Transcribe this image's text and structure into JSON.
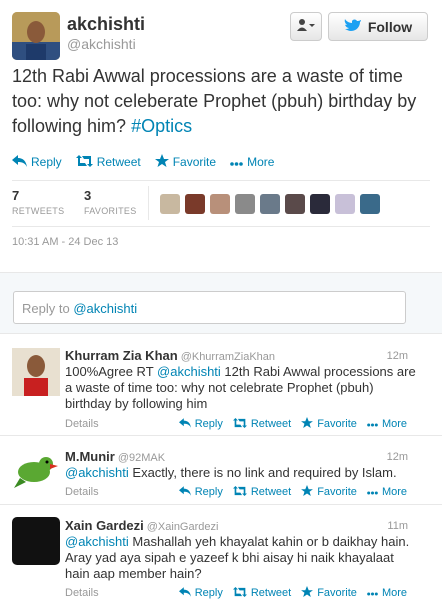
{
  "header": {
    "name": "akchishti",
    "handle": "@akchishti",
    "follow_label": "Follow"
  },
  "tweet": {
    "text": "12th Rabi Awwal processions are a waste of time too: why not celeberate Prophet (pbuh) birthday by following him?",
    "hashtag": "#Optics",
    "actions": {
      "reply": "Reply",
      "retweet": "Retweet",
      "favorite": "Favorite",
      "more": "More"
    },
    "retweets": "7",
    "retweets_label": "RETWEETS",
    "favorites": "3",
    "favorites_label": "FAVORITES",
    "date": "10:31 AM - 24 Dec 13"
  },
  "reply_box": {
    "placeholder": "Reply to ",
    "mention": "@akchishti"
  },
  "replies": [
    {
      "name": "Khurram Zia Khan",
      "handle": "@KhurramZiaKhan",
      "time": "12m",
      "text_pre": "100%Agree RT ",
      "mention": "@akchishti",
      "text_post": " 12th Rabi Awwal processions are a waste of time too: why not celebrate Prophet (pbuh) birthday by following him",
      "details": "Details"
    },
    {
      "name": "M.Munir",
      "handle": "@92MAK",
      "time": "12m",
      "mention": "@akchishti",
      "text_post": " Exactly, there is no link and required by Islam.",
      "details": "Details"
    },
    {
      "name": "Xain Gardezi",
      "handle": "@XainGardezi",
      "time": "11m",
      "mention": "@akchishti",
      "text_post": " Mashallah yeh khayalat kahin or b daikhay hain. Aray yad aya sipah e yazeef k bhi aisay hi naik khayalaat hain aap member hain?",
      "details": "Details"
    }
  ],
  "reply_actions": {
    "reply": "Reply",
    "retweet": "Retweet",
    "favorite": "Favorite",
    "more": "More"
  },
  "colors": {
    "link": "#0084b4",
    "muted": "#999999",
    "text": "#333333"
  }
}
